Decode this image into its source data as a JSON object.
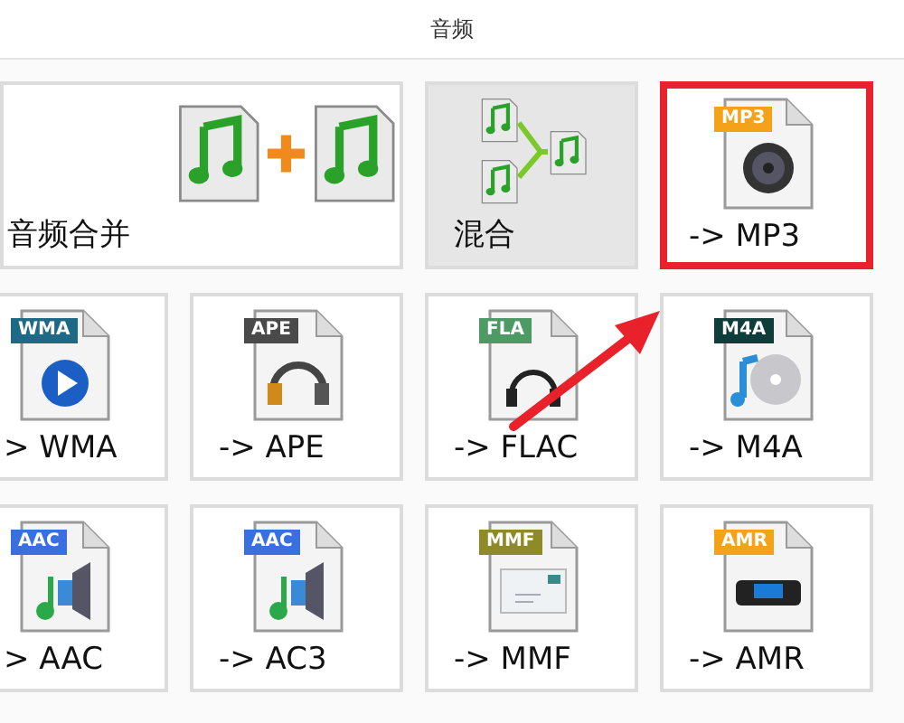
{
  "title": "音频",
  "annotation": {
    "arrow": true
  },
  "tiles": [
    {
      "kind": "merge",
      "label": "音频合并",
      "selected": false,
      "highlighted": false
    },
    {
      "kind": "mix",
      "label": "混合",
      "selected": true,
      "highlighted": false
    },
    {
      "kind": "speaker",
      "tag": "MP3",
      "color": "#f5a21b",
      "label": "-> MP3",
      "selected": false,
      "highlighted": true
    },
    {
      "kind": "play",
      "tag": "WMA",
      "color": "#1e6a86",
      "label": "> WMA",
      "selected": false,
      "highlighted": false
    },
    {
      "kind": "headset",
      "tag": "APE",
      "color": "#4a4a4a",
      "label": "-> APE",
      "selected": false,
      "highlighted": false
    },
    {
      "kind": "headphones",
      "tag": "FLA",
      "color": "#4e9a64",
      "label": "-> FLAC",
      "selected": false,
      "highlighted": false
    },
    {
      "kind": "disc",
      "tag": "M4A",
      "color": "#0f3d3a",
      "label": "-> M4A",
      "selected": false,
      "highlighted": false
    },
    {
      "kind": "note",
      "tag": "AAC",
      "color": "#3a6fe0",
      "label": "> AAC",
      "selected": false,
      "highlighted": false
    },
    {
      "kind": "note",
      "tag": "AAC",
      "color": "#3a6fe0",
      "label": "-> AC3",
      "selected": false,
      "highlighted": false
    },
    {
      "kind": "mail",
      "tag": "MMF",
      "color": "#8e8a2a",
      "label": "-> MMF",
      "selected": false,
      "highlighted": false
    },
    {
      "kind": "drive",
      "tag": "AMR",
      "color": "#f5a21b",
      "label": "-> AMR",
      "selected": false,
      "highlighted": false
    }
  ]
}
